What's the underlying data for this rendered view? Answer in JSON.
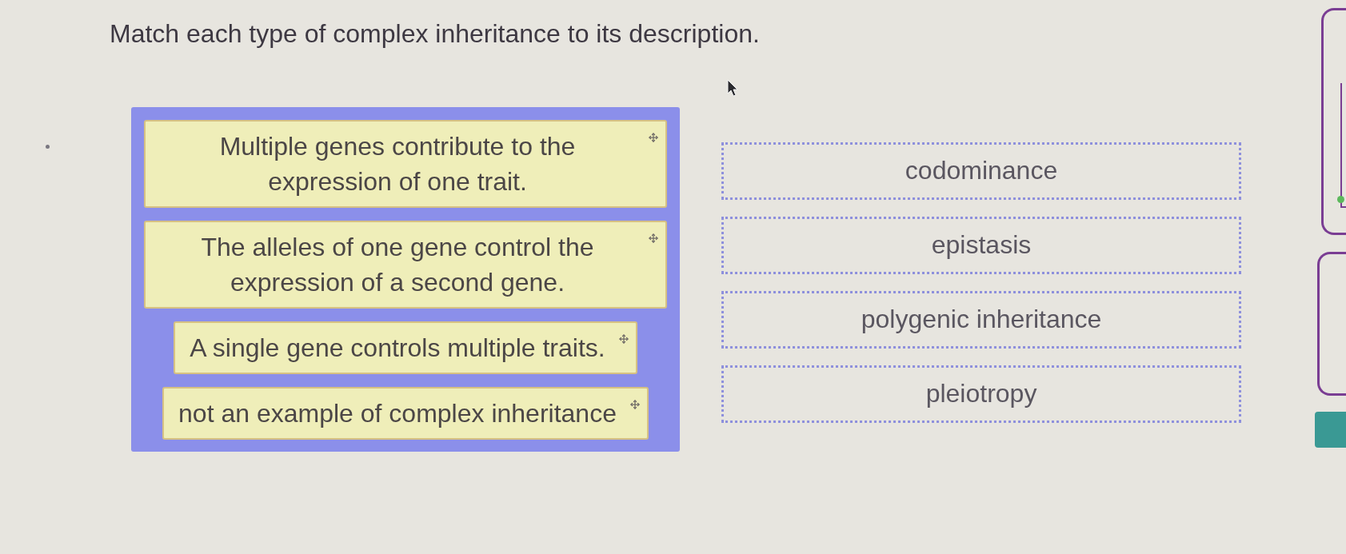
{
  "instruction": "Match each type of complex inheritance to its description.",
  "descriptions": [
    "Multiple genes contribute to the expression of one trait.",
    "The alleles of one gene control the expression of a second gene.",
    "A single gene controls multiple traits.",
    "not an example of complex inheritance"
  ],
  "terms": [
    "codominance",
    "epistasis",
    "polygenic inheritance",
    "pleiotropy"
  ]
}
